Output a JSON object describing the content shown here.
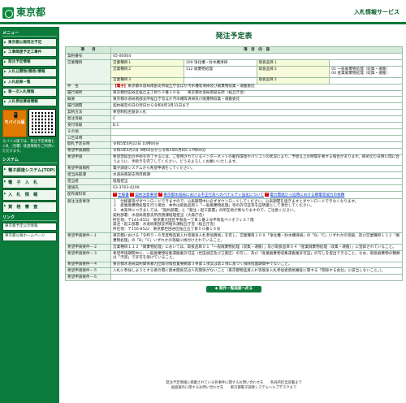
{
  "header": {
    "logo": "東京都",
    "site_name": "入札情報サービス"
  },
  "sidebar": {
    "menu_head": "メニュー",
    "items": [
      "東京都公報発注予定",
      "工事関連予定工事件",
      "発注予定情報",
      "入札公開物(簡易)情報",
      "入札結果一覧",
      "第一次入札情報",
      "入札参加資格情報"
    ],
    "mobile_label": "モバイル版",
    "mobile_note": "モバイル版では、発注予定情報と入札（見積）経過情報をご利用いただけます。",
    "system_head": "システム",
    "system_items": [
      "電子調達システム(TOP)",
      "電　子　入　札",
      "入　札　情　報",
      "資　格　審　査"
    ],
    "link_head": "リンク",
    "links": [
      "東京都予定公示情報",
      "東京都公報ホームページ"
    ]
  },
  "page": {
    "title": "発注予定表",
    "col_item": "項　　目",
    "col_content": "項　目　内　容",
    "rows": {
      "contract_no_label": "契約番号",
      "contract_no": "05-00064",
      "business_type_label": "営業種目",
      "bt1_label": "営業種目１",
      "bt1": "109 浄化槽・貯水槽清掃",
      "bt2_label": "営業種目２",
      "bt2": "112 廃棄物処理",
      "bt3_label": "営業種目３",
      "cat1_label": "取扱品目１",
      "cat2_label": "取扱品目２",
      "cat2_a": "01 一般廃棄物処理（収集・運搬）",
      "cat2_b": "04 産業廃棄物処理（収集・運搬）",
      "cat3_label": "取扱品目３",
      "item_label": "件　名",
      "item_tag": "【電子】",
      "item_name": "東京都水道局南部支所桜丘庁舎ほか汚水槽等清掃及び廃棄物収集・運搬委託",
      "place_label": "履行場所",
      "place": "東京都世田谷区桜丘五丁目５０番１６号　　東京都水道局南部支所（桜丘庁舎）",
      "summary_label": "概要",
      "summary": "東京都水道局南部支所桜丘庁舎ほか汚水槽等清掃及び廃棄物収集・運搬委託",
      "period_label": "履行期間",
      "period": "契約確定の日の翌日から令和6年3月31日まで",
      "method_label": "契約方法",
      "method": "希望制指名競争入札",
      "type_label": "発注等級",
      "type": "C",
      "accept_label": "受付等級",
      "accept": "B,C",
      "other_label": "その他",
      "pub_date_label": "公告日時",
      "pub_date": "",
      "open_date_label": "開札予定日時",
      "open_date": "令和5年6月22日 10時00分",
      "apply_period_label": "希望申請期間",
      "apply_period": "令和5年6月2日 9時00分から令和5年6月8日 17時00分",
      "apply_method_label": "希望申請",
      "apply_method": "希望票提出の手続を完了するには、ご使用されているインターネットの動作環境やパソコンの状況により、予想以上の時間を要する場合があります。締め切り日時に間に合うように、手続きを完了してください。どうぞよろしくお願いいたします。",
      "apply_way_label": "希望申請場所",
      "apply_way": "電子調達システムから希望申請をしてください。",
      "dept_label": "担当局部課",
      "dept": "水道局南部支所庶務課",
      "person_label": "担当者",
      "person": "経理担当",
      "tel_label": "連絡先",
      "tel": "03-3763-4209",
      "docs_label": "配布資料等",
      "doc1": "仕様書",
      "doc2": "契約注意事項",
      "doc3": "東京都水道局における不正行為へのペナルティ強化について",
      "doc4": "電力需給ひっ迫時における節電等協力の依頼",
      "notes_label": "発注注意事項",
      "notes": "１　仕様書等がダウンロードできますので、公表期間中に必ずダウンロードしてください。公表期間を過ぎますとダウンロードできなくなります。\n２　産業廃棄物処理を行う場合、本件は取扱品目１「一般廃棄物処理」等の許可証等を証明書として添付してください。\n３　本案件につきましては、「契約部署」と「発注・起工部署」の所在地が異なりますので、ご注意ください。\n契約部署：水道局南部支所庶務課経理担当（大森庁舎）\n所在地：〒143-8552　東京都大田区平和島一丁目１番２号平和島ペイオフィス７階\n発注・起工部署：水道局南部支所給水課桜丘庁舎（桜丘庁舎）\n所在地：〒156-8522　東京都世田谷区桜丘五丁目５０番１６号",
      "req1_label": "希望申請要件－１",
      "req1": "東京都における「令和５・６年度物品買入れ等競争入札参加資格」を有し、営業種目１０９「浄化槽・貯水槽清掃」の「B」「C」いずれかの等級、及び営業種目１１２「廃棄物処理」の「B」「C」いずれかの等級に格付けされていること。",
      "req2_label": "希望申請要件－２",
      "req2": "営業種目１１２「廃棄物処理」においては、取扱品目０１「一般廃棄物処理（収集・運搬）」及び取扱品目０４「産業廃棄物処理（収集・運搬）」に登録されていること。",
      "req3_label": "希望申請要件－３",
      "req3": "希望申請期間中に、一般廃棄物収集運搬業許可証（世田谷区及び江東区）の写し、及び「産業廃棄物収集運搬業許可証」の写しを提出できること。なお、取扱廃棄物の種類は「汚泥」で許可を受けていること。",
      "req4_label": "希望申請要件－４",
      "req4": "東京都水道局契約関係暴力団等対策措置要綱第３条第１項又は第２項に基づく排除措置期間中でないこと。",
      "req5_label": "希望申請要件－５",
      "req5": "入札に参加しようとする者の間に資本関係又は人的関係がないこと（東京都物品買入れ等競争入札参加者資格審査に関する「関係する会社」に該当しないこと。）。",
      "req6_label": "希望申請要件－６",
      "req6": ""
    },
    "back_button": "◆ 案件一覧画面へ戻る"
  },
  "footer": {
    "line1": "発注予定情報に掲載されている各事件に関するお問い合わせ先　　各局所担当部署まで",
    "line2": "画面操作に関するお問い合わせ先　　東京都電子調達システムヘルプデスクまで"
  }
}
